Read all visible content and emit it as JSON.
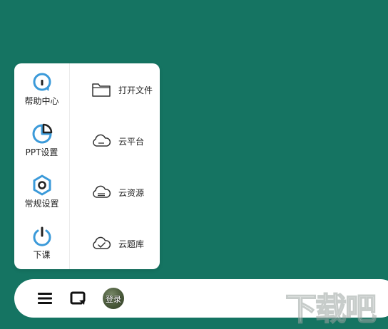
{
  "colors": {
    "background": "#157462",
    "icon_blue": "#3b9ad9",
    "icon_dark": "#222222"
  },
  "menu": {
    "left_items": [
      {
        "label": "帮助中心",
        "icon": "help-icon"
      },
      {
        "label": "PPT设置",
        "icon": "pie-chart-icon"
      },
      {
        "label": "常规设置",
        "icon": "settings-icon"
      },
      {
        "label": "下课",
        "icon": "power-icon"
      }
    ],
    "right_items": [
      {
        "label": "打开文件",
        "icon": "folder-icon"
      },
      {
        "label": "云平台",
        "icon": "cloud-icon"
      },
      {
        "label": "云资源",
        "icon": "cloud-resource-icon"
      },
      {
        "label": "云题库",
        "icon": "cloud-check-icon"
      }
    ]
  },
  "bottom_bar": {
    "menu_icon": "hamburger-menu-icon",
    "screen_icon": "screen-switch-icon",
    "login_label": "登录"
  },
  "watermark": {
    "text": "下载吧"
  }
}
